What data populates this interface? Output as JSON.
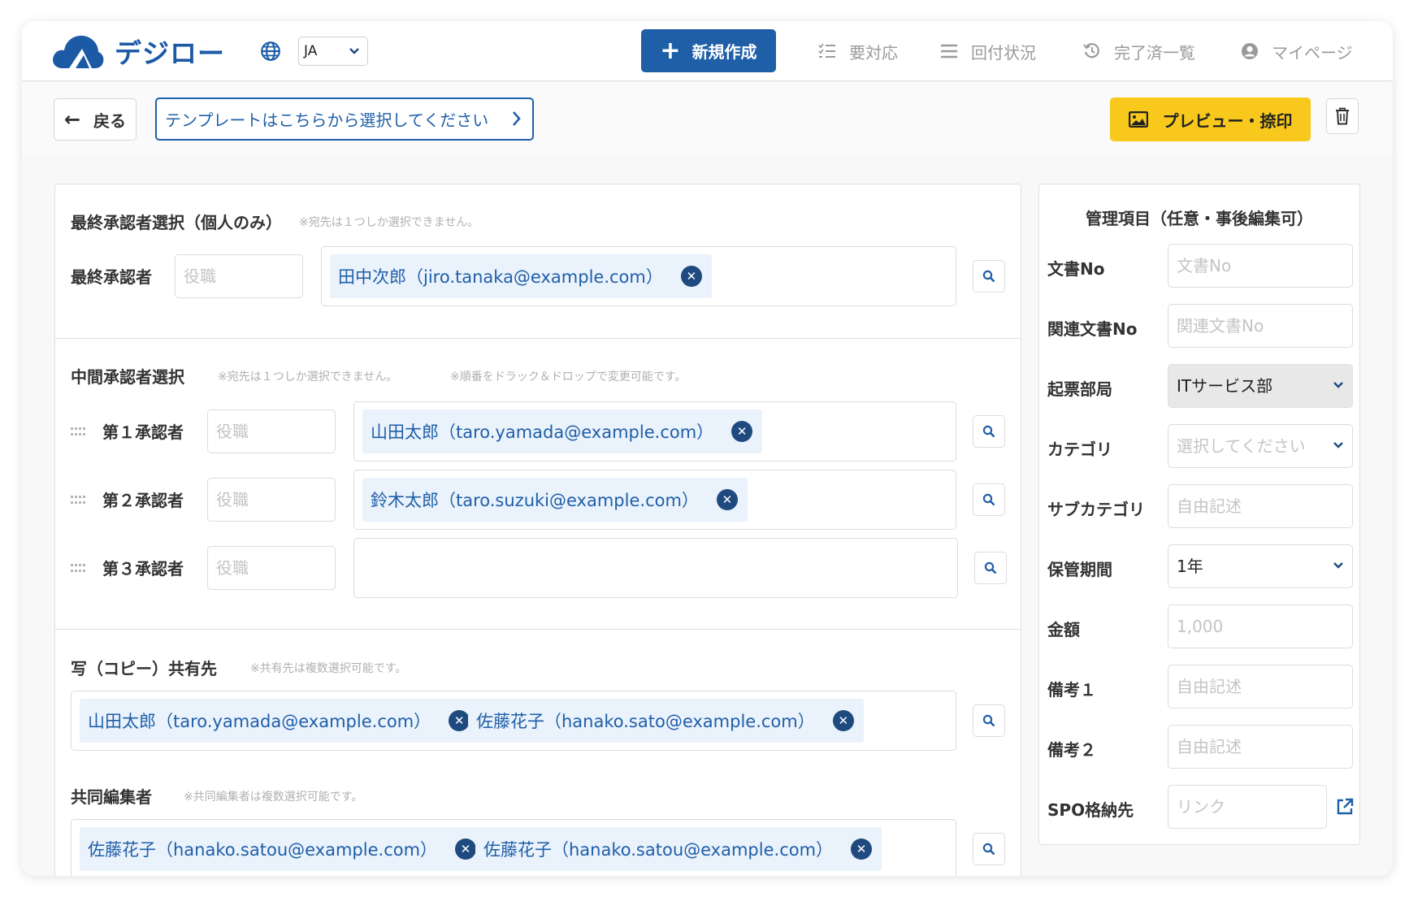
{
  "header": {
    "logo_text": "デジロー",
    "language": "JA",
    "new_button": "新規作成",
    "nav": [
      {
        "label": "要対応",
        "icon": "checklist-icon"
      },
      {
        "label": "回付状況",
        "icon": "list-icon"
      },
      {
        "label": "完了済一覧",
        "icon": "history-icon"
      },
      {
        "label": "マイページ",
        "icon": "user-icon"
      }
    ]
  },
  "toolbar": {
    "back": "戻る",
    "template": "テンプレートはこちらから選択してください",
    "preview": "プレビュー・捺印"
  },
  "final": {
    "title": "最終承認者選択（個人のみ）",
    "note": "※宛先は１つしか選択できません。",
    "label": "最終承認者",
    "role_placeholder": "役職",
    "chips": [
      "田中次郎（jiro.tanaka@example.com）"
    ]
  },
  "middle": {
    "title": "中間承認者選択",
    "note1": "※宛先は１つしか選択できません。",
    "note2": "※順番をドラック＆ドロップで変更可能です。",
    "rows": [
      {
        "label": "第１承認者",
        "role_placeholder": "役職",
        "chips": [
          "山田太郎（taro.yamada@example.com）"
        ]
      },
      {
        "label": "第２承認者",
        "role_placeholder": "役職",
        "chips": [
          "鈴木太郎（taro.suzuki@example.com）"
        ]
      },
      {
        "label": "第３承認者",
        "role_placeholder": "役職",
        "chips": []
      }
    ]
  },
  "copy": {
    "title": "写（コピー）共有先",
    "note": "※共有先は複数選択可能です。",
    "chips": [
      "山田太郎（taro.yamada@example.com）",
      "佐藤花子（hanako.sato@example.com）"
    ]
  },
  "coedit": {
    "title": "共同編集者",
    "note": "※共同編集者は複数選択可能です。",
    "chips": [
      "佐藤花子（hanako.satou@example.com）",
      "佐藤花子（hanako.satou@example.com）"
    ]
  },
  "manage": {
    "title": "管理項目（任意・事後編集可）",
    "fields": [
      {
        "label": "文書No",
        "placeholder": "文書No",
        "value": ""
      },
      {
        "label": "関連文書No",
        "placeholder": "関連文書No",
        "value": ""
      },
      {
        "label": "起票部局",
        "placeholder": "",
        "value": "ITサービス部"
      },
      {
        "label": "カテゴリ",
        "placeholder": "選択してください",
        "value": ""
      },
      {
        "label": "サブカテゴリ",
        "placeholder": "自由記述",
        "value": ""
      },
      {
        "label": "保管期間",
        "placeholder": "",
        "value": "1年"
      },
      {
        "label": "金額",
        "placeholder": "1,000",
        "value": ""
      },
      {
        "label": "備考１",
        "placeholder": "自由記述",
        "value": ""
      },
      {
        "label": "備考２",
        "placeholder": "自由記述",
        "value": ""
      },
      {
        "label": "SPO格納先",
        "placeholder": "リンク",
        "value": ""
      }
    ]
  },
  "colors": {
    "primary": "#1f5fa8",
    "accent": "#f8c91c",
    "chip_bg": "#eaf2fb"
  }
}
